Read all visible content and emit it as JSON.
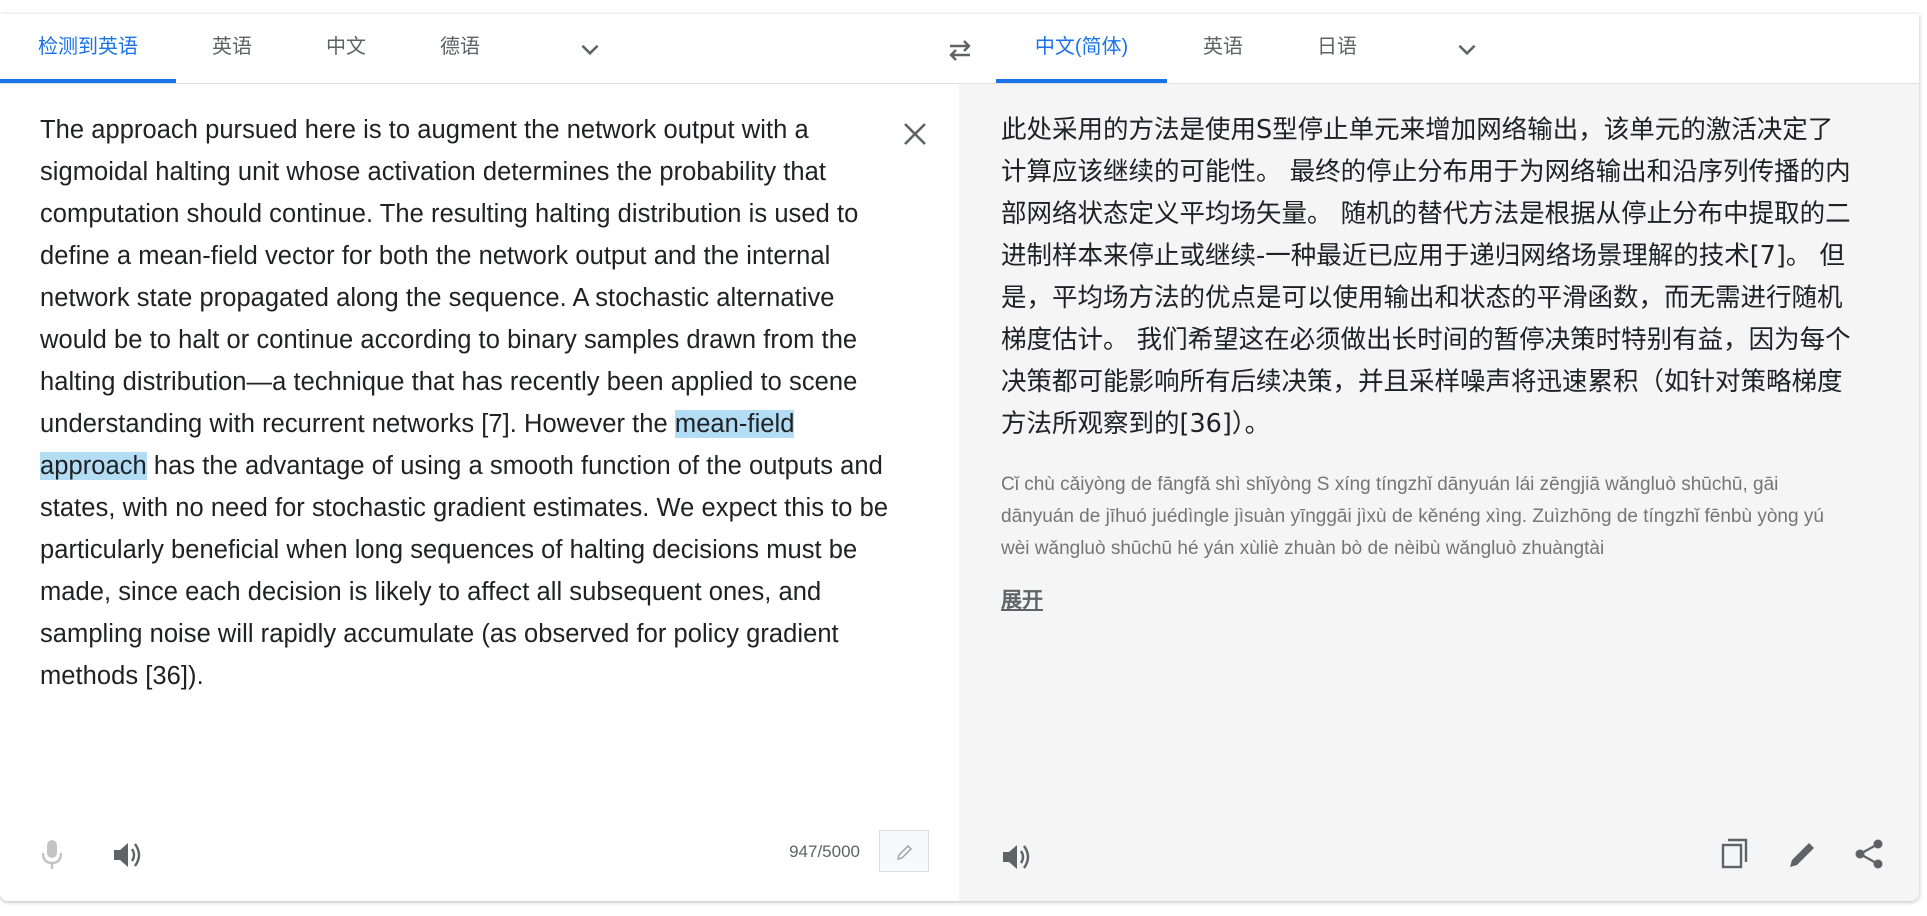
{
  "source_tabs": [
    {
      "label": "检测到英语",
      "active": true
    },
    {
      "label": "英语",
      "active": false
    },
    {
      "label": "中文",
      "active": false
    },
    {
      "label": "德语",
      "active": false
    }
  ],
  "target_tabs": [
    {
      "label": "中文(简体)",
      "active": true
    },
    {
      "label": "英语",
      "active": false
    },
    {
      "label": "日语",
      "active": false
    }
  ],
  "source": {
    "text_before": "The approach pursued here is to augment the network output with a sigmoidal halting unit whose activation determines the probability that computation should continue. The resulting halting distribution is used to define a mean-field vector for both the network output and the internal network state propagated along the sequence. A stochastic alternative would be to halt or continue according to binary samples drawn from the halting distribution—a technique that has recently been applied to scene understanding with recurrent networks [7]. However the ",
    "text_highlight": "mean-field approach",
    "text_after": " has the advantage of using a smooth function of the outputs and states, with no need for stochastic gradient estimates. We expect this to be particularly beneficial when long sequences of halting decisions must be made, since each decision is likely to affect all subsequent ones, and sampling noise will rapidly accumulate (as observed for policy gradient methods [36]).",
    "char_count": "947/5000"
  },
  "target": {
    "text": "此处采用的方法是使用S型停止单元来增加网络输出，该单元的激活决定了计算应该继续的可能性。 最终的停止分布用于为网络输出和沿序列传播的内部网络状态定义平均场矢量。 随机的替代方法是根据从停止分布中提取的二进制样本来停止或继续-一种最近已应用于递归网络场景理解的技术[7]。 但是，平均场方法的优点是可以使用输出和状态的平滑函数，而无需进行随机梯度估计。 我们希望这在必须做出长时间的暂停决策时特别有益，因为每个决策都可能影响所有后续决策，并且采样噪声将迅速累积（如针对策略梯度方法所观察到的[36]）。",
    "pinyin": "Cǐ chù cǎiyòng de fāngfǎ shì shǐyòng S xíng tíngzhǐ dānyuán lái zēngjiā wǎngluò shūchū, gāi dānyuán de jīhuó juédìngle jìsuàn yīnggāi jìxù de kěnéng xìng. Zuìzhōng de tíngzhǐ fēnbù yòng yú wèi wǎngluò shūchū hé yán xùliè zhuàn bò de nèibù wǎngluò zhuàngtài",
    "expand_label": "展开"
  },
  "icons": {
    "source_dropdown": "chevron-down-icon",
    "swap": "swap-arrows-icon",
    "target_dropdown": "chevron-down-icon",
    "clear": "close-icon",
    "mic": "microphone-icon",
    "listen": "speaker-icon",
    "edit": "pencil-icon",
    "copy": "copy-icon",
    "suggest_edit": "pencil-icon",
    "share": "share-icon"
  },
  "colors": {
    "accent": "#1a73e8",
    "highlight": "#b3dcf5",
    "target_bg": "#f5f5f5"
  }
}
